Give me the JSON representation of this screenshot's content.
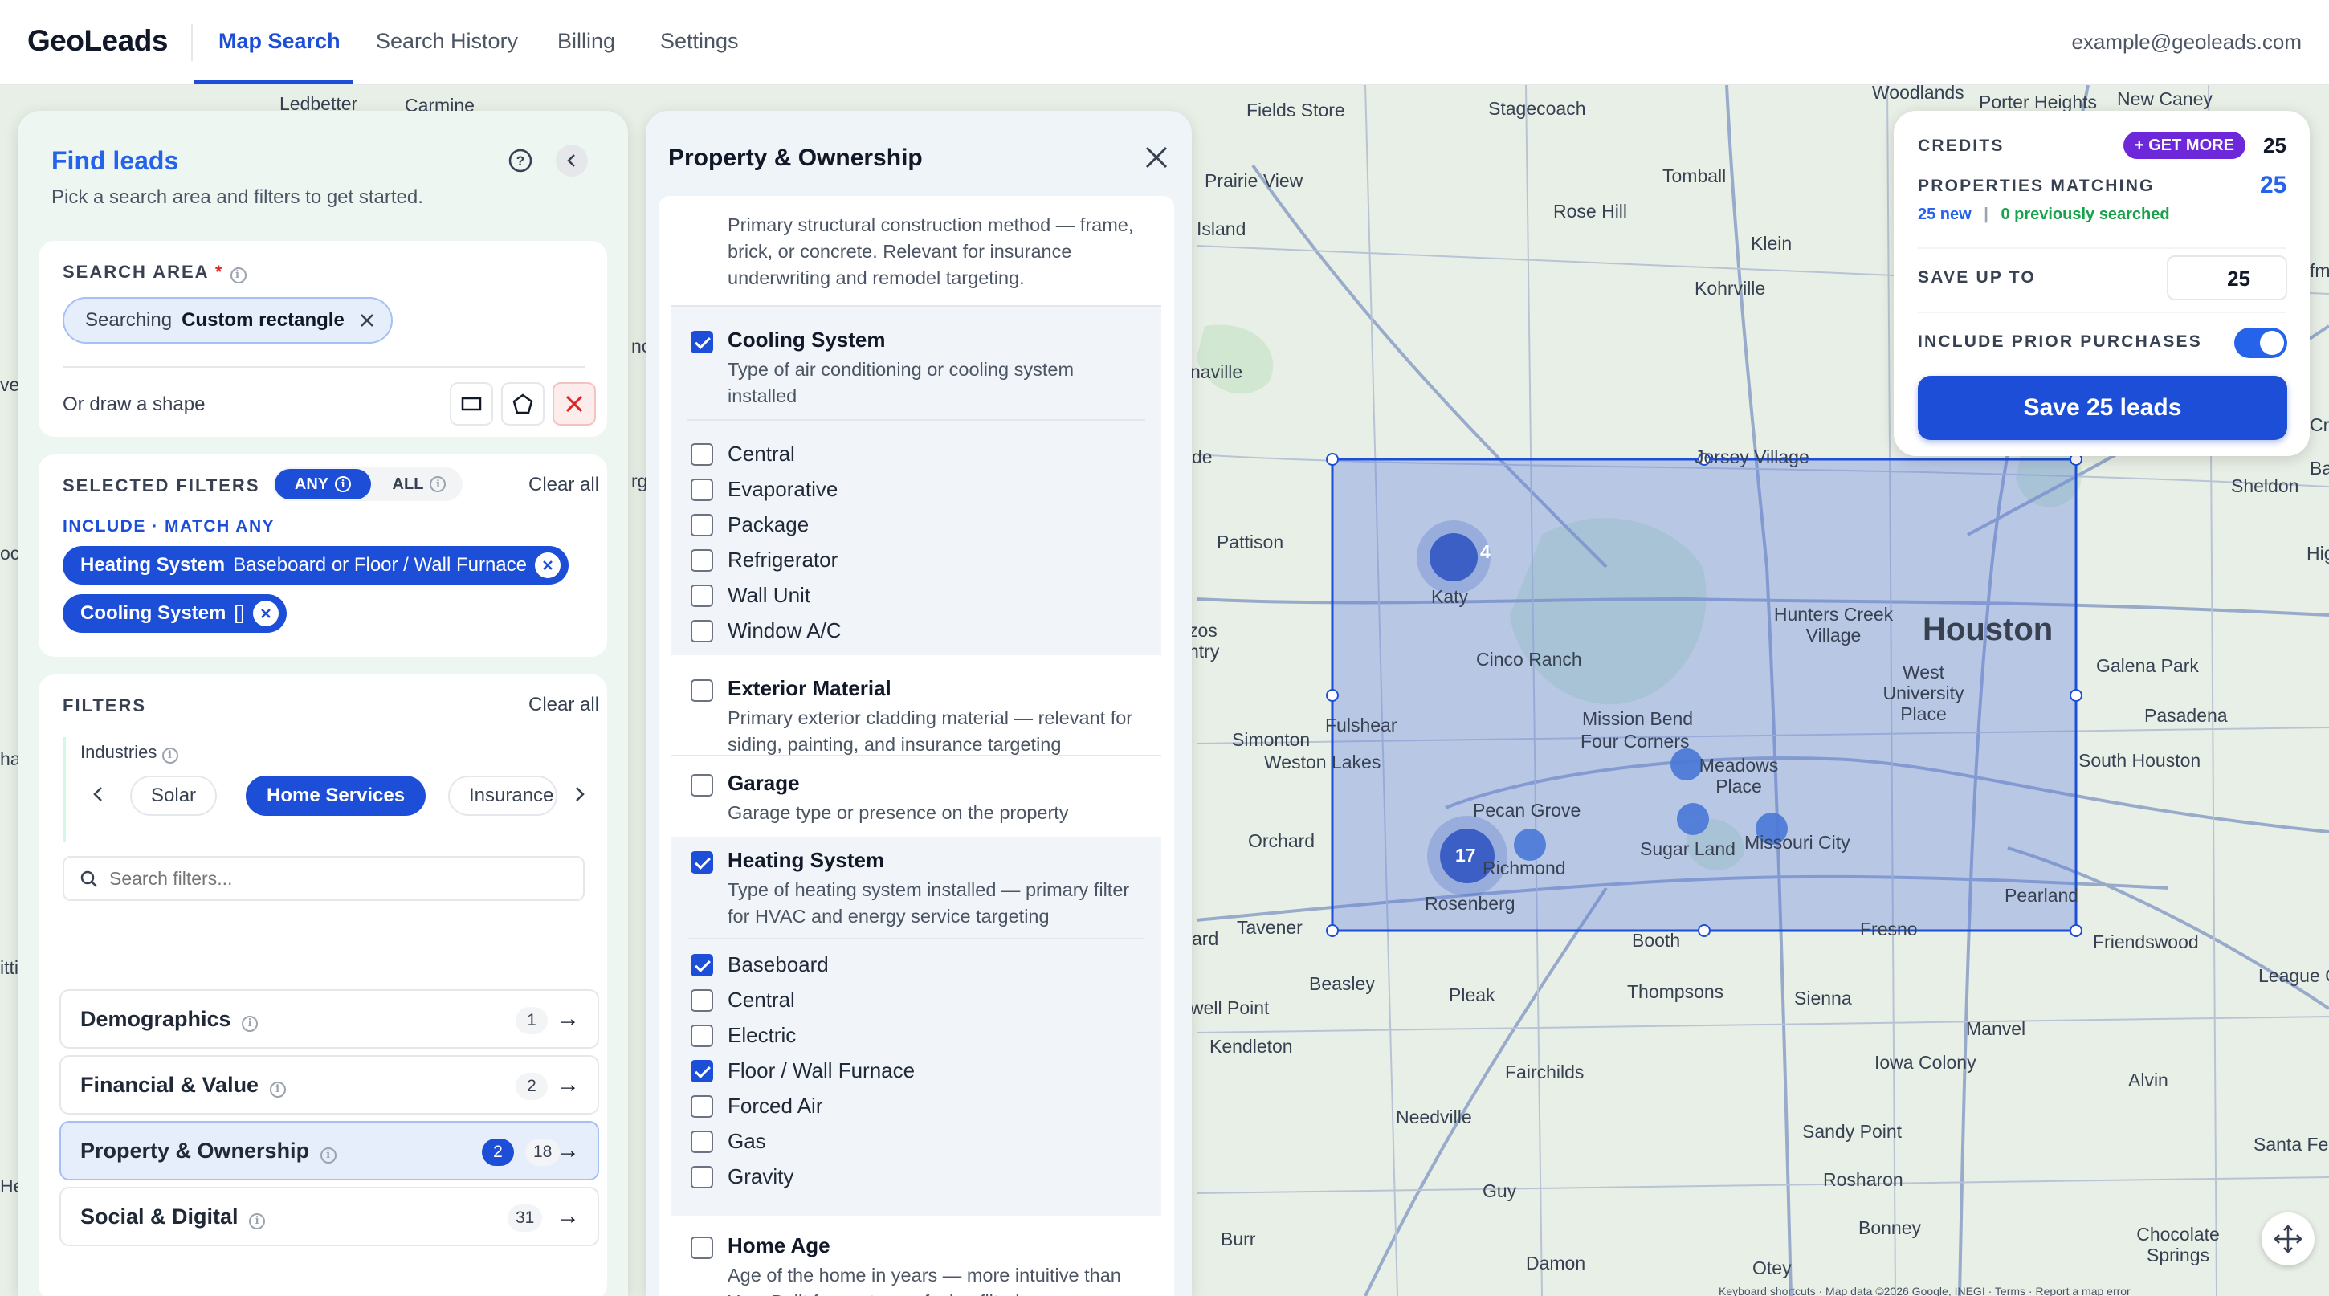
{
  "header": {
    "logo": "GeoLeads",
    "tabs": [
      {
        "label": "Map Search"
      },
      {
        "label": "Search History"
      },
      {
        "label": "Billing"
      },
      {
        "label": "Settings"
      }
    ],
    "user_email": "example@geoleads.com"
  },
  "find_leads": {
    "title": "Find leads",
    "subtitle": "Pick a search area and filters to get started.",
    "search_area": {
      "label": "SEARCH AREA",
      "required_mark": "*",
      "chip_prefix": "Searching",
      "chip_value": "Custom rectangle",
      "draw_prompt": "Or draw a shape"
    },
    "selected_filters": {
      "label": "SELECTED FILTERS",
      "any_label": "ANY",
      "all_label": "ALL",
      "clear_label": "Clear all",
      "include_label": "INCLUDE · MATCH ANY",
      "chips": [
        {
          "name": "Heating System",
          "value": "Baseboard or Floor / Wall Furnace"
        },
        {
          "name": "Cooling System",
          "value": "[]"
        }
      ]
    },
    "filters": {
      "label": "FILTERS",
      "clear_label": "Clear all",
      "industries_label": "Industries",
      "industries": [
        "Solar",
        "Home Services",
        "Insurance"
      ],
      "active_industry": "Home Services",
      "search_placeholder": "Search filters...",
      "categories": [
        {
          "label": "Demographics",
          "count": "1",
          "selected": ""
        },
        {
          "label": "Financial & Value",
          "count": "2",
          "selected": ""
        },
        {
          "label": "Property & Ownership",
          "count": "18",
          "selected": "2"
        },
        {
          "label": "Social & Digital",
          "count": "31",
          "selected": ""
        }
      ]
    }
  },
  "property_panel": {
    "title": "Property & Ownership",
    "top_desc": "Primary structural construction method — frame, brick, or concrete. Relevant for insurance underwriting and remodel targeting.",
    "cooling": {
      "title": "Cooling System",
      "desc": "Type of air conditioning or cooling system installed",
      "checked": true,
      "options": [
        {
          "label": "Central",
          "checked": false
        },
        {
          "label": "Evaporative",
          "checked": false
        },
        {
          "label": "Package",
          "checked": false
        },
        {
          "label": "Refrigerator",
          "checked": false
        },
        {
          "label": "Wall Unit",
          "checked": false
        },
        {
          "label": "Window A/C",
          "checked": false
        }
      ]
    },
    "exterior": {
      "title": "Exterior Material",
      "desc": "Primary exterior cladding material — relevant for siding, painting, and insurance targeting"
    },
    "garage": {
      "title": "Garage",
      "desc": "Garage type or presence on the property"
    },
    "heating": {
      "title": "Heating System",
      "desc": "Type of heating system installed — primary filter for HVAC and energy service targeting",
      "checked": true,
      "options": [
        {
          "label": "Baseboard",
          "checked": true
        },
        {
          "label": "Central",
          "checked": false
        },
        {
          "label": "Electric",
          "checked": false
        },
        {
          "label": "Floor / Wall Furnace",
          "checked": true
        },
        {
          "label": "Forced Air",
          "checked": false
        },
        {
          "label": "Gas",
          "checked": false
        },
        {
          "label": "Gravity",
          "checked": false
        }
      ]
    },
    "home_age": {
      "title": "Home Age",
      "desc": "Age of the home in years — more intuitive than Year Built for customer-facing filtering"
    }
  },
  "credits_card": {
    "credits_label": "CREDITS",
    "get_more_label": "+ GET MORE",
    "credits_value": "25",
    "matching_label": "PROPERTIES MATCHING",
    "matching_value": "25",
    "new_text": "25 new",
    "prev_text": "0 previously searched",
    "save_up_label": "SAVE UP TO",
    "save_up_value": "25",
    "prior_label": "INCLUDE PRIOR PURCHASES",
    "prior_enabled": true,
    "save_button": "Save 25 leads"
  },
  "map": {
    "labels": [
      "Ledbetter",
      "Carmine",
      "Fields Store",
      "Stagecoach",
      "Woodlands",
      "Porter Heights",
      "New Caney",
      "Prairie View",
      "Tomball",
      "Rose Hill",
      "Klein",
      "Island",
      "Kohrville",
      "naville",
      "de",
      "Jersey Village",
      "Sheldon",
      "Pattison",
      "Katy",
      "Hunters Creek Village",
      "Houston",
      "West University Place",
      "Galena Park",
      "Cinco Ranch",
      "Fulshear",
      "Pasadena",
      "Simonton",
      "Weston Lakes",
      "Mission Bend",
      "Four Corners",
      "Meadows Place",
      "South Houston",
      "Pecan Grove",
      "Orchard",
      "Richmond",
      "Sugar Land",
      "Missouri City",
      "Rosenberg",
      "Pearland",
      "Tavener",
      "Booth",
      "Fresno",
      "Friendswood",
      "League C",
      "Beasley",
      "Pleak",
      "Thompsons",
      "Sienna",
      "well Point",
      "Manvel",
      "Kendleton",
      "Iowa Colony",
      "Alvin",
      "Fairchilds",
      "Needville",
      "Sandy Point",
      "Santa Fe",
      "Rosharon",
      "Guy",
      "Bonney",
      "Chocolate Springs",
      "Burr",
      "Damon",
      "Otey",
      "Hig",
      "Ba",
      "Cr",
      "fm",
      "zos",
      "ntry",
      "ard",
      "nc",
      "rg",
      "oc",
      "ves",
      "itti",
      "ha",
      "He"
    ],
    "clusters": [
      "4",
      "17"
    ],
    "attribution": "Keyboard shortcuts · Map data ©2026 Google, INEGI · Terms · Report a map error"
  },
  "colors": {
    "accent": "#1d4ed8",
    "selection_fill": "#5b7fe0",
    "map_bg": "#e8efe6"
  }
}
